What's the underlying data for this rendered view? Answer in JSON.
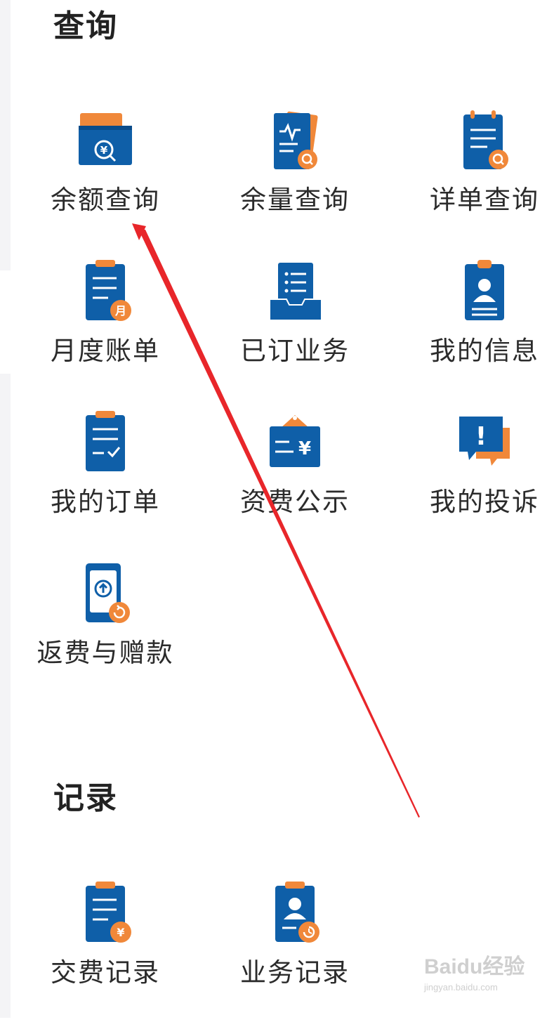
{
  "sections": {
    "query": {
      "title": "查询",
      "items": [
        {
          "label": "余额查询",
          "icon": "balance-card-icon"
        },
        {
          "label": "余量查询",
          "icon": "usage-report-icon"
        },
        {
          "label": "详单查询",
          "icon": "detail-list-icon"
        },
        {
          "label": "月度账单",
          "icon": "monthly-bill-icon"
        },
        {
          "label": "已订业务",
          "icon": "subscribed-services-icon"
        },
        {
          "label": "我的信息",
          "icon": "profile-badge-icon"
        },
        {
          "label": "我的订单",
          "icon": "order-clipboard-icon"
        },
        {
          "label": "资费公示",
          "icon": "tariff-sign-icon"
        },
        {
          "label": "我的投诉",
          "icon": "complaint-chat-icon"
        },
        {
          "label": "返费与赠款",
          "icon": "refund-phone-icon"
        }
      ]
    },
    "records": {
      "title": "记录",
      "items": [
        {
          "label": "交费记录",
          "icon": "payment-record-icon"
        },
        {
          "label": "业务记录",
          "icon": "service-record-icon"
        }
      ]
    }
  },
  "icon_glyphs": {
    "balance": "¥",
    "monthly_bill": "月",
    "tariff": "¥",
    "payment": "¥",
    "complaint": "!"
  },
  "watermark": {
    "brand": "Baidu经验",
    "url": "jingyan.baidu.com"
  },
  "colors": {
    "icon_blue": "#0f5fa8",
    "icon_orange": "#f0883a",
    "text": "#2b2b2b",
    "annotation_red": "#e8262a"
  }
}
